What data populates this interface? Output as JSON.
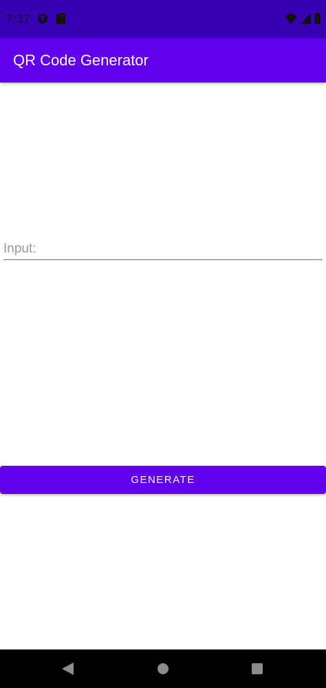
{
  "status_bar": {
    "time": "7:37",
    "left_icons": [
      "data-saver-icon",
      "sd-card-icon"
    ],
    "right_icons": [
      "wifi-icon",
      "cellular-signal-icon",
      "battery-icon"
    ]
  },
  "app_bar": {
    "title": "QR Code Generator"
  },
  "input": {
    "placeholder": "Input:",
    "value": ""
  },
  "generate_button": {
    "label": "GENERATE"
  },
  "nav_bar": {
    "buttons": [
      "back-icon",
      "home-icon",
      "recents-icon"
    ]
  },
  "colors": {
    "status_bar": "#3700b3",
    "primary": "#6200ee",
    "nav_bar": "#000000"
  }
}
